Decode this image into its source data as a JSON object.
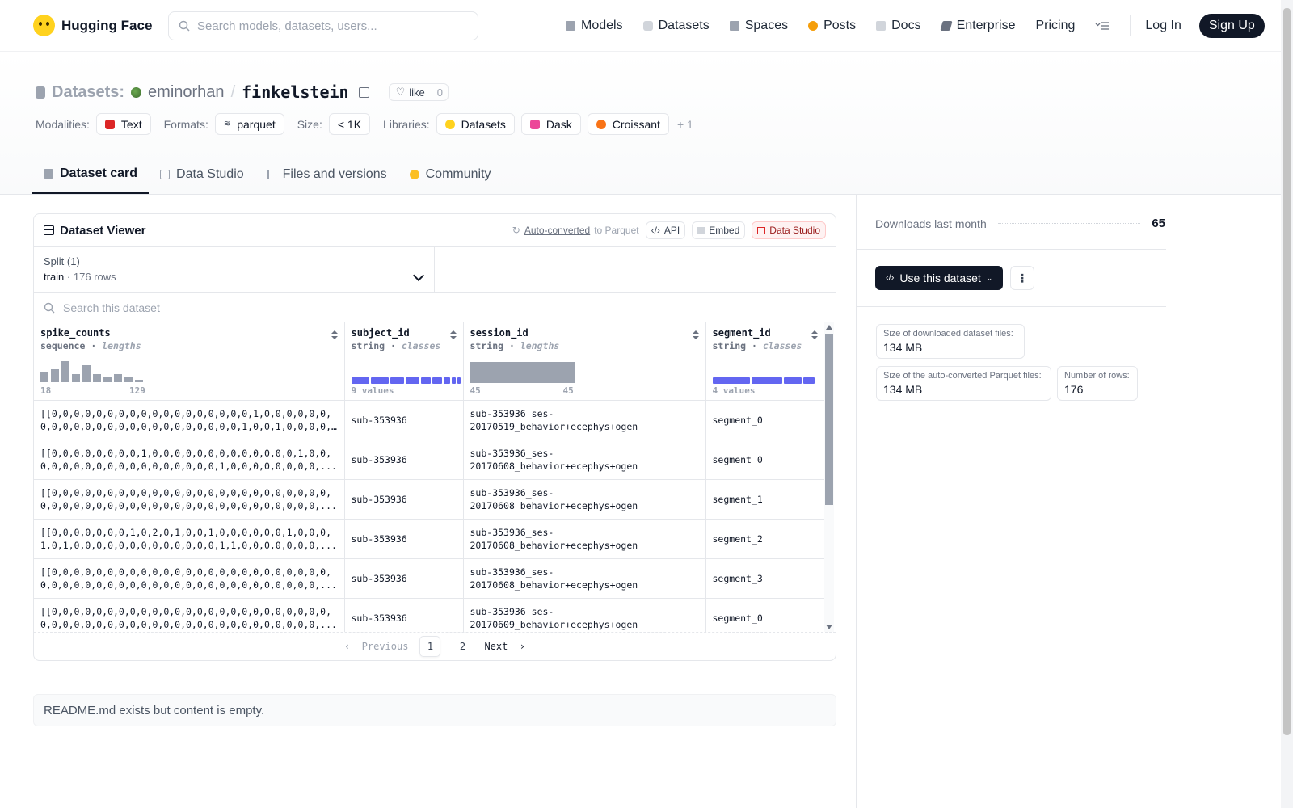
{
  "nav": {
    "brand": "Hugging Face",
    "search_placeholder": "Search models, datasets, users...",
    "links": [
      "Models",
      "Datasets",
      "Spaces",
      "Posts",
      "Docs",
      "Enterprise",
      "Pricing"
    ],
    "login": "Log In",
    "signup": "Sign Up"
  },
  "header": {
    "section": "Datasets:",
    "owner": "eminorhan",
    "name": "finkelstein",
    "like_label": "like",
    "like_count": "0",
    "modalities_label": "Modalities:",
    "modality": "Text",
    "formats_label": "Formats:",
    "format": "parquet",
    "size_label": "Size:",
    "size": "< 1K",
    "libraries_label": "Libraries:",
    "libraries": [
      "Datasets",
      "Dask",
      "Croissant"
    ],
    "libraries_more": "+ 1",
    "tabs": [
      "Dataset card",
      "Data Studio",
      "Files and versions",
      "Community"
    ]
  },
  "viewer": {
    "title": "Dataset Viewer",
    "autoconv_link": "Auto-converted",
    "autoconv_rest": "to Parquet",
    "api": "API",
    "embed": "Embed",
    "data_studio": "Data Studio",
    "split_label": "Split (1)",
    "split_name": "train",
    "split_rows": "176 rows",
    "search_placeholder": "Search this dataset",
    "columns": [
      {
        "name": "spike_counts",
        "type": "sequence",
        "stat": "lengths",
        "axis_min": "18",
        "axis_max": "129",
        "hist": [
          0.45,
          0.6,
          1.0,
          0.4,
          0.8,
          0.4,
          0.22,
          0.4,
          0.22,
          0.1
        ]
      },
      {
        "name": "subject_id",
        "type": "string",
        "stat": "classes",
        "values_label": "9 values"
      },
      {
        "name": "session_id",
        "type": "string",
        "stat": "lengths",
        "axis_min": "45",
        "axis_max": "45"
      },
      {
        "name": "segment_id",
        "type": "string",
        "stat": "classes",
        "values_label": "4 values"
      }
    ],
    "rows": [
      [
        "[[0,0,0,0,0,0,0,0,0,0,0,0,0,0,0,0,0,0,1,0,0,0,0,0,0,0,0,0,0,0,0,0,0,0,0,0,0,0,0,0,0,0,0,1,0,0,1,0,0,0,0,0,...",
        "sub-353936",
        "sub-353936_ses-20170519_behavior+ecephys+ogen",
        "segment_0"
      ],
      [
        "[[0,0,0,0,0,0,0,0,1,0,0,0,0,0,0,0,0,0,0,0,0,0,1,0,0,0,0,0,0,0,0,0,0,0,0,0,0,0,0,0,0,1,0,0,0,0,0,0,0,0,...",
        "sub-353936",
        "sub-353936_ses-20170608_behavior+ecephys+ogen",
        "segment_0"
      ],
      [
        "[[0,0,0,0,0,0,0,0,0,0,0,0,0,0,0,0,0,0,0,0,0,0,0,0,0,0,0,0,0,0,0,0,0,0,0,0,0,0,0,0,0,0,0,0,0,0,0,0,0,0,...",
        "sub-353936",
        "sub-353936_ses-20170608_behavior+ecephys+ogen",
        "segment_1"
      ],
      [
        "[[0,0,0,0,0,0,0,1,0,2,0,1,0,0,1,0,0,0,0,0,0,1,0,0,0,1,0,1,0,0,0,0,0,0,0,0,0,0,0,0,0,1,1,0,0,0,0,0,0,0,...",
        "sub-353936",
        "sub-353936_ses-20170608_behavior+ecephys+ogen",
        "segment_2"
      ],
      [
        "[[0,0,0,0,0,0,0,0,0,0,0,0,0,0,0,0,0,0,0,0,0,0,0,0,0,0,0,0,0,0,0,0,0,0,0,0,0,0,0,0,0,0,0,0,0,0,0,0,0,0,...",
        "sub-353936",
        "sub-353936_ses-20170608_behavior+ecephys+ogen",
        "segment_3"
      ],
      [
        "[[0,0,0,0,0,0,0,0,0,0,0,0,0,0,0,0,0,0,0,0,0,0,0,0,0,0,0,0,0,0,0,0,0,0,0,0,0,0,0,0,0,0,0,0,0,0,0,0,0,0,...",
        "sub-353936",
        "sub-353936_ses-20170609_behavior+ecephys+ogen",
        "segment_0"
      ]
    ],
    "pager": {
      "prev": "Previous",
      "pages": [
        "1",
        "2"
      ],
      "next": "Next"
    }
  },
  "readme": "README.md exists but content is empty.",
  "side": {
    "downloads_label": "Downloads last month",
    "downloads": "65",
    "use_button": "Use this dataset",
    "stats": [
      {
        "label": "Size of downloaded dataset files:",
        "value": "134 MB"
      },
      {
        "label": "Size of the auto-converted Parquet files:",
        "value": "134 MB"
      },
      {
        "label": "Number of rows:",
        "value": "176"
      }
    ]
  },
  "colors": {
    "accent": "#6366f1",
    "dark": "#111827",
    "hist": "#9ca3af",
    "brand": "#FFD21E"
  }
}
